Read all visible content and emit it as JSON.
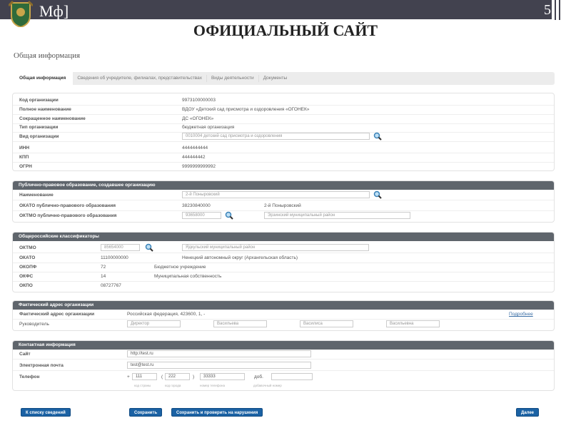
{
  "header": {
    "brand": "Мф]",
    "slide_number": "5",
    "title": "ОФИЦИАЛЬНЫЙ САЙТ"
  },
  "page_title": "Общая информация",
  "tabs": [
    "Общая информация",
    "Сведения об учредителе, филиалах, представительствах",
    "Виды деятельности",
    "Документы"
  ],
  "general": {
    "rows": [
      {
        "label": "Код организации",
        "value": "9973100000003"
      },
      {
        "label": "Полное наименование",
        "value": "ВДОУ «Детский сад присмотра и оздоровления «ОГОНЕК»"
      },
      {
        "label": "Сокращенное наименование",
        "value": "ДС «ОГОНЕК»"
      },
      {
        "label": "Тип организации",
        "value": "бюджетная организация"
      },
      {
        "label": "Вид организации",
        "value": "0010004 детский сад присмотра и оздоровления"
      },
      {
        "label": "ИНН",
        "value": "4444444444"
      },
      {
        "label": "КПП",
        "value": "444444442"
      },
      {
        "label": "ОГРН",
        "value": "9999999999992"
      }
    ]
  },
  "ppo": {
    "title": "Публично-правовое образование, создавшее организацию",
    "name_label": "Наименование",
    "name_value": "2-й Поныровский",
    "okato_label": "ОКАТО публично-правового образования",
    "okato_code": "38230840000",
    "okato_name": "2-й Поныровский",
    "oktmo_label": "ОКТМО публично-правового образования",
    "oktmo_code": "93658000",
    "oktmo_name": "Эрзинский муниципальный район"
  },
  "classifiers": {
    "title": "Общероссийские классификаторы",
    "oktmo": {
      "label": "ОКТМО",
      "code": "85654000",
      "name": "Ядкульский муниципальный район"
    },
    "okato": {
      "label": "ОКАТО",
      "code": "11100000000",
      "name": "Ненецкий автономный округ (Архангельская область)"
    },
    "okopf": {
      "label": "ОКОПФ",
      "code": "72",
      "name": "Бюджетное учреждение"
    },
    "okfs": {
      "label": "ОКФС",
      "code": "14",
      "name": "Муниципальная собственность"
    },
    "okpo": {
      "label": "ОКПО",
      "code": "08727767"
    }
  },
  "address": {
    "title": "Фактический адрес организации",
    "label": "Фактический адрес организации",
    "value": "Российская федерация, 423600, 1, -",
    "more_link": "Подробнее",
    "head_label": "Руководитель",
    "head_fields": [
      "Директор",
      "Васильева",
      "Василиса",
      "Васильевна"
    ]
  },
  "contacts": {
    "title": "Контактная информация",
    "site_label": "Сайт",
    "site": "http://test.ru",
    "email_label": "Электронная почта",
    "email": "test@test.ru",
    "phone_label": "Телефон",
    "plus": "+",
    "lparen": "(",
    "rparen": ")",
    "country": "111",
    "city": "222",
    "number": "33333",
    "ext_label": "доб.",
    "ext": "",
    "captions": [
      "код страны",
      "код города",
      "номер телефона",
      "добавочный номер"
    ]
  },
  "buttons": {
    "back": "К списку сведений",
    "save": "Сохранить",
    "save_check": "Сохранить и проверить на нарушения",
    "next": "Далее"
  }
}
